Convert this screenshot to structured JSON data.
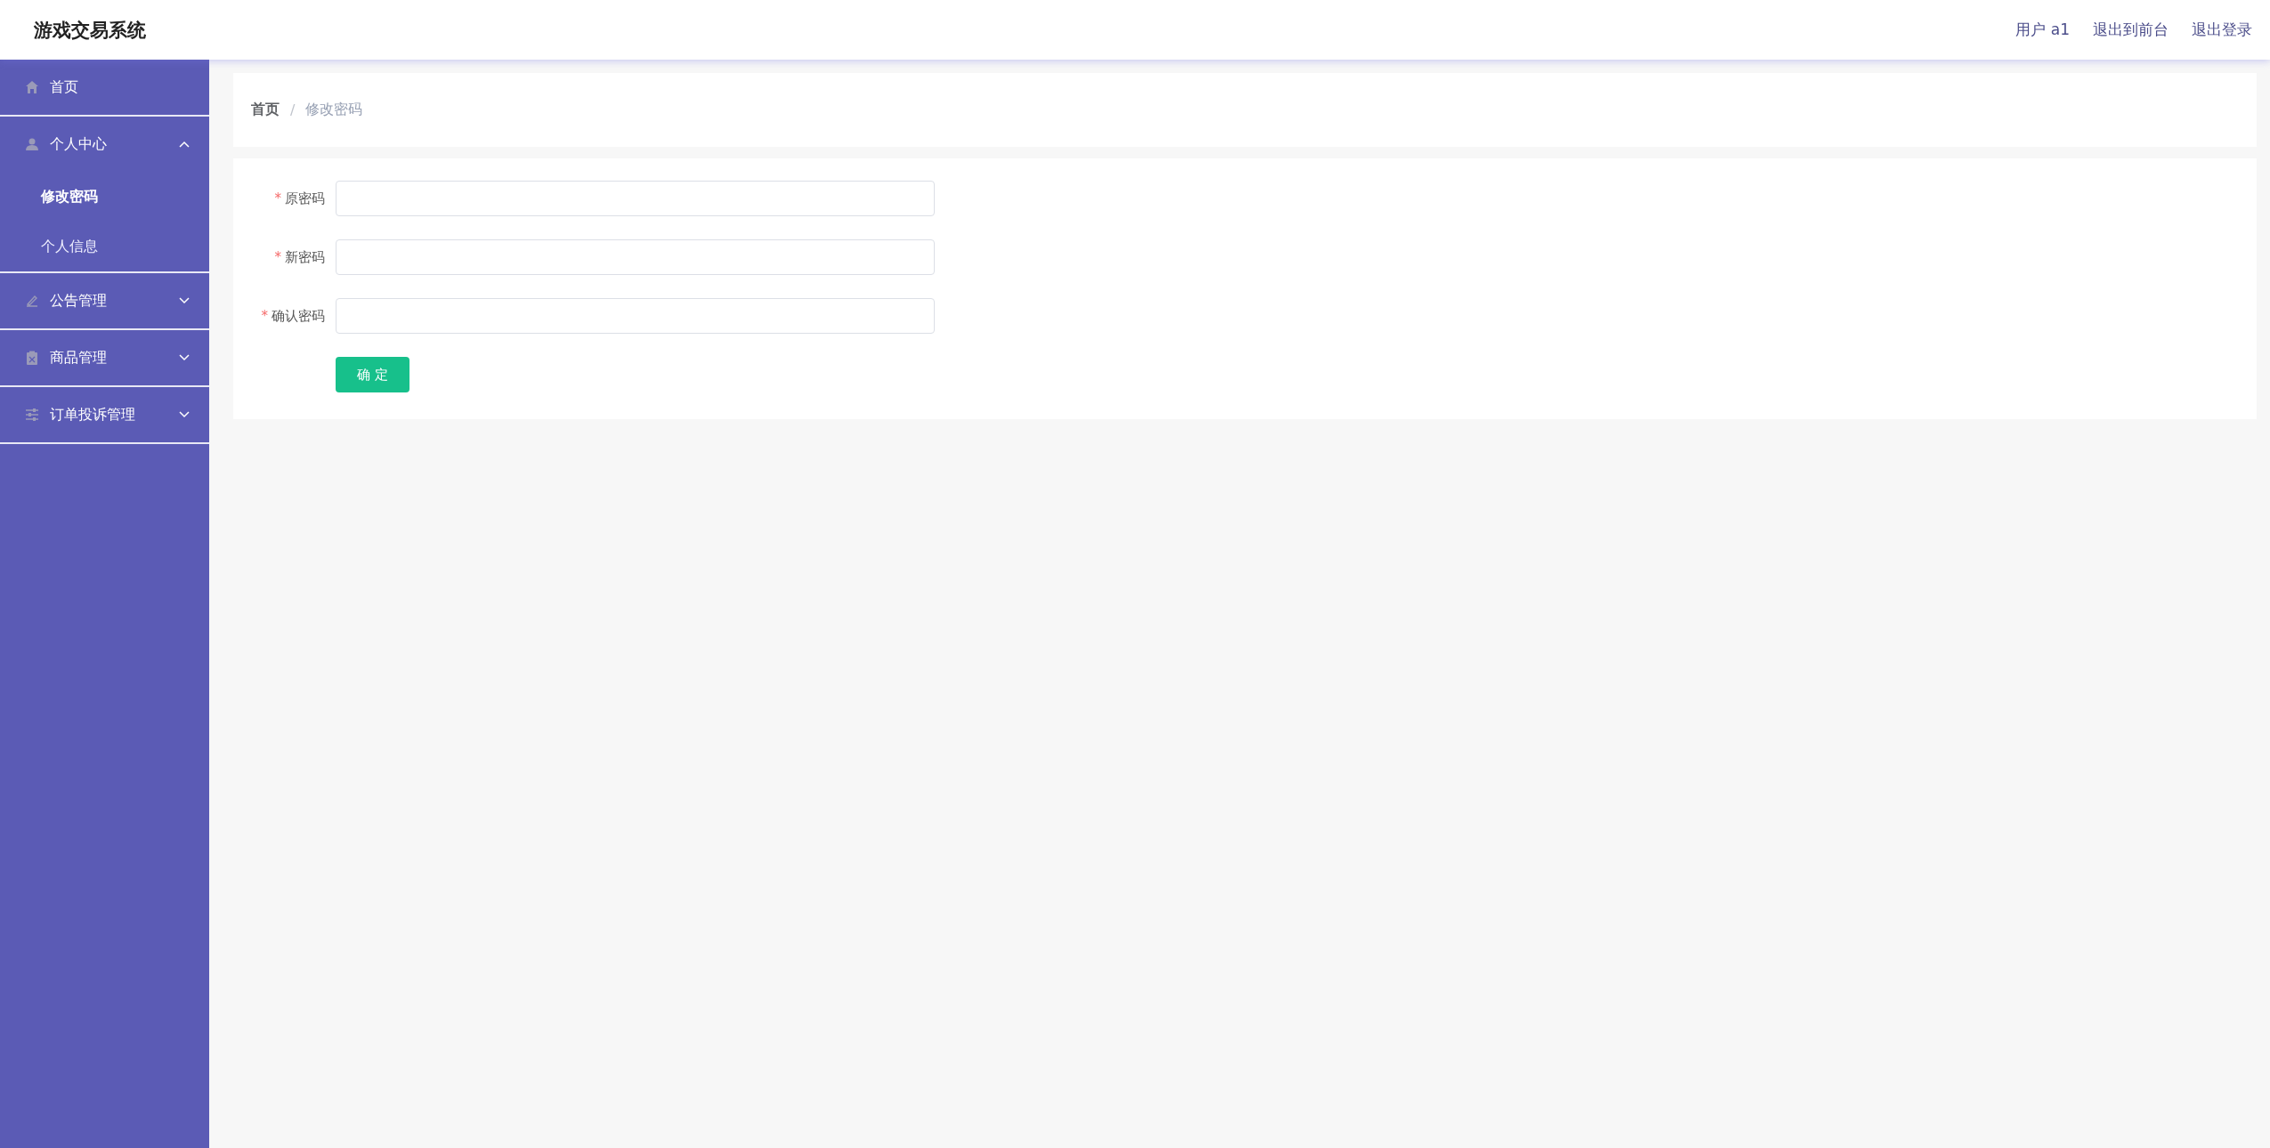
{
  "header": {
    "title": "游戏交易系统",
    "links": [
      "用户 a1",
      "退出到前台",
      "退出登录"
    ]
  },
  "sidebar": {
    "items": [
      {
        "label": "首页",
        "expanded": false,
        "has_submenu": false
      },
      {
        "label": "个人中心",
        "expanded": true,
        "has_submenu": true,
        "children": [
          {
            "label": "修改密码",
            "selected": true
          },
          {
            "label": "个人信息",
            "selected": false
          }
        ]
      },
      {
        "label": "公告管理",
        "expanded": false,
        "has_submenu": true
      },
      {
        "label": "商品管理",
        "expanded": false,
        "has_submenu": true
      },
      {
        "label": "订单投诉管理",
        "expanded": false,
        "has_submenu": true
      }
    ]
  },
  "breadcrumb": [
    {
      "label": "首页",
      "current": false
    },
    {
      "label": "修改密码",
      "current": true
    }
  ],
  "breadcrumb_separator": "/",
  "form": {
    "fields": [
      {
        "label": "原密码",
        "required": true
      },
      {
        "label": "新密码",
        "required": true
      },
      {
        "label": "确认密码",
        "required": true
      }
    ],
    "required_mark": "*",
    "submit": "确 定"
  }
}
